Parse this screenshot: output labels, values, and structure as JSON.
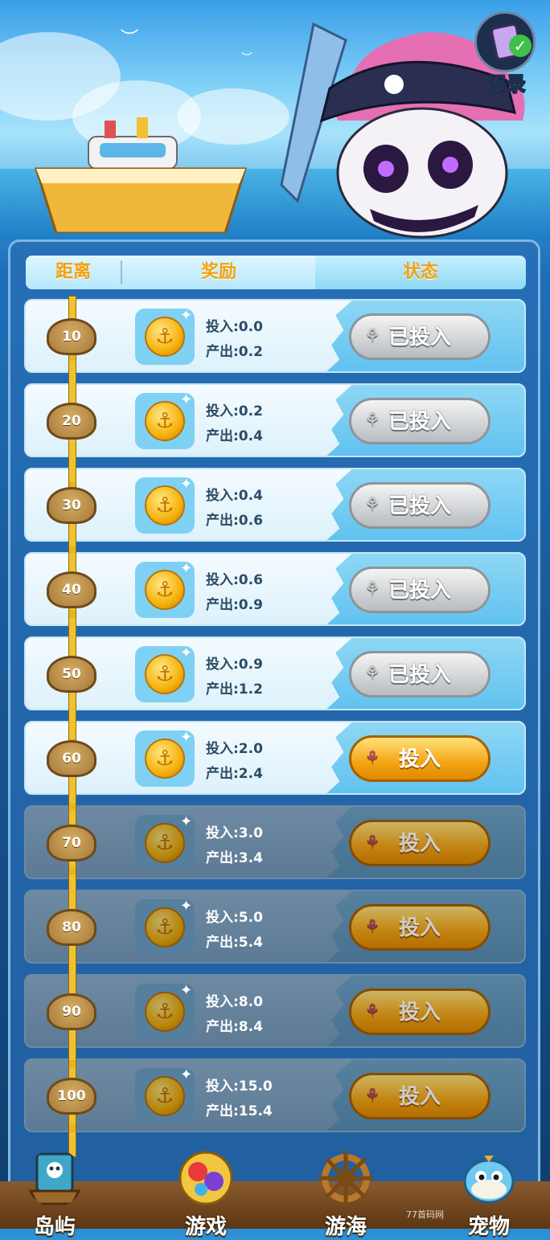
{
  "record_button": {
    "label": "记录"
  },
  "table_header": {
    "distance": "距离",
    "reward": "奖励",
    "status": "状态"
  },
  "rows": [
    {
      "distance": "10",
      "invest": "投入:0.0",
      "output": "产出:0.2",
      "button": "已投入",
      "state": "done"
    },
    {
      "distance": "20",
      "invest": "投入:0.2",
      "output": "产出:0.4",
      "button": "已投入",
      "state": "done"
    },
    {
      "distance": "30",
      "invest": "投入:0.4",
      "output": "产出:0.6",
      "button": "已投入",
      "state": "done"
    },
    {
      "distance": "40",
      "invest": "投入:0.6",
      "output": "产出:0.9",
      "button": "已投入",
      "state": "done"
    },
    {
      "distance": "50",
      "invest": "投入:0.9",
      "output": "产出:1.2",
      "button": "已投入",
      "state": "done"
    },
    {
      "distance": "60",
      "invest": "投入:2.0",
      "output": "产出:2.4",
      "button": "投入",
      "state": "available"
    },
    {
      "distance": "70",
      "invest": "投入:3.0",
      "output": "产出:3.4",
      "button": "投入",
      "state": "locked"
    },
    {
      "distance": "80",
      "invest": "投入:5.0",
      "output": "产出:5.4",
      "button": "投入",
      "state": "locked"
    },
    {
      "distance": "90",
      "invest": "投入:8.0",
      "output": "产出:8.4",
      "button": "投入",
      "state": "locked"
    },
    {
      "distance": "100",
      "invest": "投入:15.0",
      "output": "产出:15.4",
      "button": "投入",
      "state": "locked"
    }
  ],
  "bottom_nav": [
    {
      "label": "岛屿",
      "icon": "island-map-icon"
    },
    {
      "label": "游戏",
      "icon": "gems-icon"
    },
    {
      "label": "游海",
      "icon": "ship-wheel-icon"
    },
    {
      "label": "宠物",
      "icon": "pufferfish-icon"
    }
  ],
  "watermark": "77首码网",
  "colors": {
    "header_text": "#f3a10f",
    "invest_button": "#f3a414",
    "done_button": "#b8bcc0",
    "track": "#f1c22d"
  }
}
